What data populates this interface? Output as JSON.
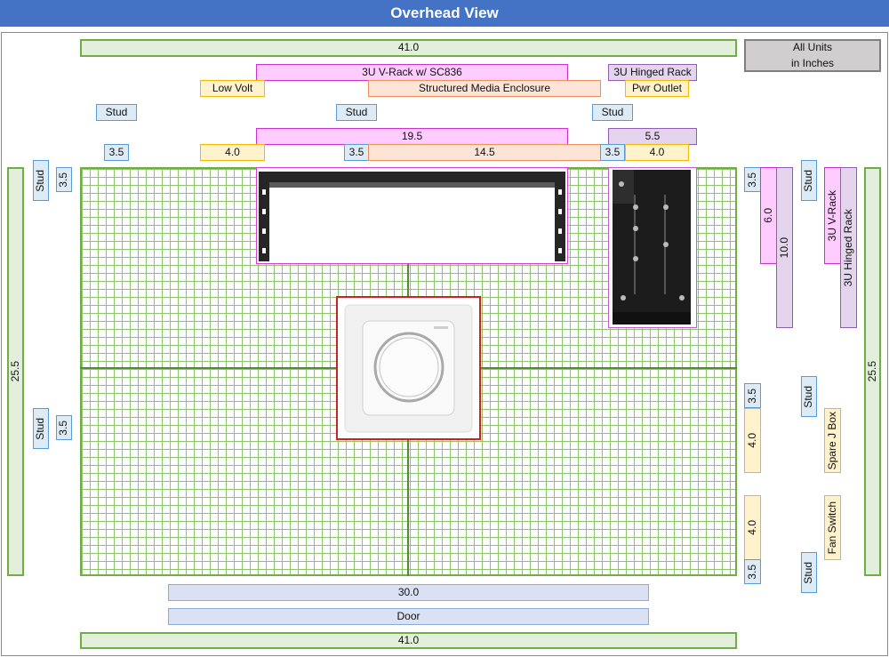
{
  "title": "Overhead View",
  "units_note": "All Units\nin Inches",
  "dims": {
    "top_width": "41.0",
    "bottom_width": "41.0",
    "left_depth": "25.5",
    "right_depth": "25.5",
    "door_width": "30.0",
    "vrack_width": "19.5",
    "hinged_width": "5.5",
    "studgap_left": "3.5",
    "lowvolt_width": "4.0",
    "studgap_mid": "3.5",
    "sme_width": "14.5",
    "studgap_right": "3.5",
    "pwr_width": "4.0",
    "left_stud_gap_top": "3.5",
    "left_stud_gap_bottom": "3.5",
    "right_stud_gap_top": "3.5",
    "vrack_depth": "6.0",
    "hinged_depth": "10.0",
    "right_stud_gap_mid": "3.5",
    "spare_jbox_height": "4.0",
    "fan_switch_height": "4.0",
    "right_stud_gap_bottom": "3.5"
  },
  "labels": {
    "vrack": "3U V-Rack w/ SC836",
    "hinged": "3U Hinged Rack",
    "low_volt": "Low Volt",
    "sme": "Structured Media Enclosure",
    "pwr_outlet": "Pwr Outlet",
    "stud": "Stud",
    "door": "Door",
    "vrack_side": "3U V-Rack",
    "hinged_side": "3U Hinged Rack",
    "spare_jbox": "Spare J Box",
    "fan_switch": "Fan Switch"
  },
  "colors": {
    "title_bar": "#4472c4",
    "grid_line": "#8fc46e",
    "grid_border": "#70ad47",
    "vrack": "#ffccff",
    "hinged_rack": "#e4d4ee",
    "yellow_item": "#fff2cc",
    "sme": "#fce4d6",
    "stud": "#ddebf7",
    "door": "#d9e1f2",
    "fan_outline": "#cc2222"
  }
}
